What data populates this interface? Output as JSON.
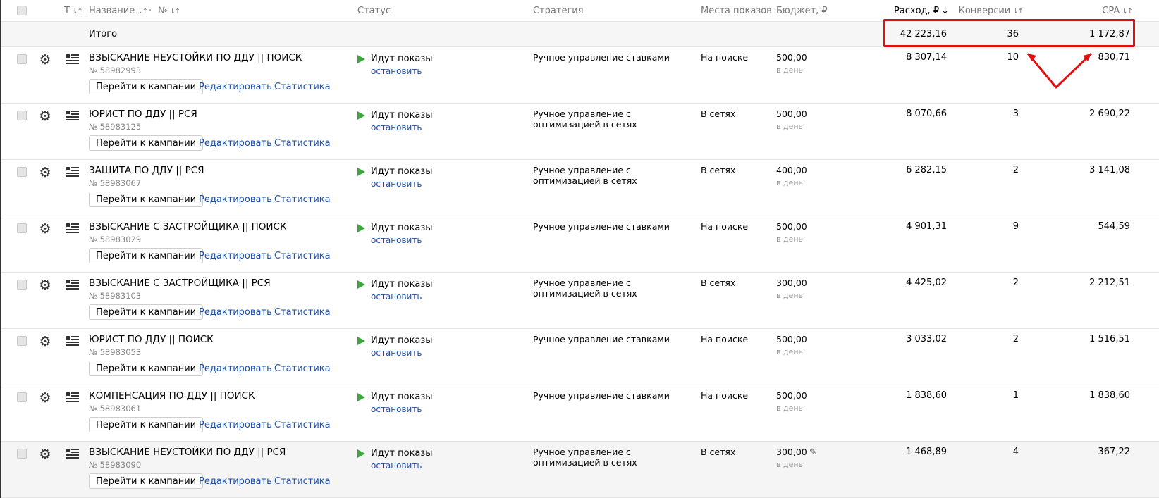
{
  "header": {
    "type_marker": "Т",
    "name": "Название",
    "dot": "·",
    "number": "№",
    "status": "Статус",
    "strategy": "Стратегия",
    "placements": "Места показов",
    "budget": "Бюджет, ₽",
    "spend": "Расход, ₽",
    "conversions": "Конверсии",
    "cpa": "CPA",
    "sort_icon": "⇂↑",
    "sort_active_icon": "↓"
  },
  "total": {
    "label": "Итого",
    "spend": "42 223,16",
    "conversions": "36",
    "cpa": "1 172,87"
  },
  "labels": {
    "go_to_campaign": "Перейти к кампании",
    "edit": "Редактировать",
    "stats": "Статистика",
    "stop": "остановить",
    "per_day": "в день"
  },
  "campaigns": [
    {
      "name": "ВЗЫСКАНИЕ НЕУСТОЙКИ ПО ДДУ || ПОИСК",
      "id": "№ 58982993",
      "status": "Идут показы",
      "strategy": "Ручное управление ставками",
      "placement": "На поиске",
      "budget": "500,00",
      "spend": "8 307,14",
      "conversions": "10",
      "cpa": "830,71"
    },
    {
      "name": "ЮРИСТ ПО ДДУ || РСЯ",
      "id": "№ 58983125",
      "status": "Идут показы",
      "strategy": "Ручное управление с оптимизацией в сетях",
      "placement": "В сетях",
      "budget": "500,00",
      "spend": "8 070,66",
      "conversions": "3",
      "cpa": "2 690,22"
    },
    {
      "name": "ЗАЩИТА ПО ДДУ || РСЯ",
      "id": "№ 58983067",
      "status": "Идут показы",
      "strategy": "Ручное управление с оптимизацией в сетях",
      "placement": "В сетях",
      "budget": "400,00",
      "spend": "6 282,15",
      "conversions": "2",
      "cpa": "3 141,08"
    },
    {
      "name": "ВЗЫСКАНИЕ С ЗАСТРОЙЩИКА || ПОИСК",
      "id": "№ 58983029",
      "status": "Идут показы",
      "strategy": "Ручное управление ставками",
      "placement": "На поиске",
      "budget": "500,00",
      "spend": "4 901,31",
      "conversions": "9",
      "cpa": "544,59"
    },
    {
      "name": "ВЗЫСКАНИЕ С ЗАСТРОЙЩИКА || РСЯ",
      "id": "№ 58983103",
      "status": "Идут показы",
      "strategy": "Ручное управление с оптимизацией в сетях",
      "placement": "В сетях",
      "budget": "300,00",
      "spend": "4 425,02",
      "conversions": "2",
      "cpa": "2 212,51"
    },
    {
      "name": "ЮРИСТ ПО ДДУ || ПОИСК",
      "id": "№ 58983053",
      "status": "Идут показы",
      "strategy": "Ручное управление ставками",
      "placement": "На поиске",
      "budget": "500,00",
      "spend": "3 033,02",
      "conversions": "2",
      "cpa": "1 516,51"
    },
    {
      "name": "КОМПЕНСАЦИЯ ПО ДДУ || ПОИСК",
      "id": "№ 58983061",
      "status": "Идут показы",
      "strategy": "Ручное управление ставками",
      "placement": "На поиске",
      "budget": "500,00",
      "spend": "1 838,60",
      "conversions": "1",
      "cpa": "1 838,60"
    },
    {
      "name": "ВЗЫСКАНИЕ НЕУСТОЙКИ ПО ДДУ || РСЯ",
      "id": "№ 58983090",
      "status": "Идут показы",
      "strategy": "Ручное управление с оптимизацией в сетях",
      "placement": "В сетях",
      "budget": "300,00",
      "spend": "1 468,89",
      "conversions": "4",
      "cpa": "367,22"
    }
  ],
  "colors": {
    "accent_link": "#1f4fa0",
    "play_green": "#3aa93a",
    "highlight_red": "#e01010"
  },
  "icons": {
    "row_settings": "gear-icon",
    "row_lines": "lines-icon",
    "status_play": "play-icon",
    "budget_edit": "pencil-icon"
  }
}
